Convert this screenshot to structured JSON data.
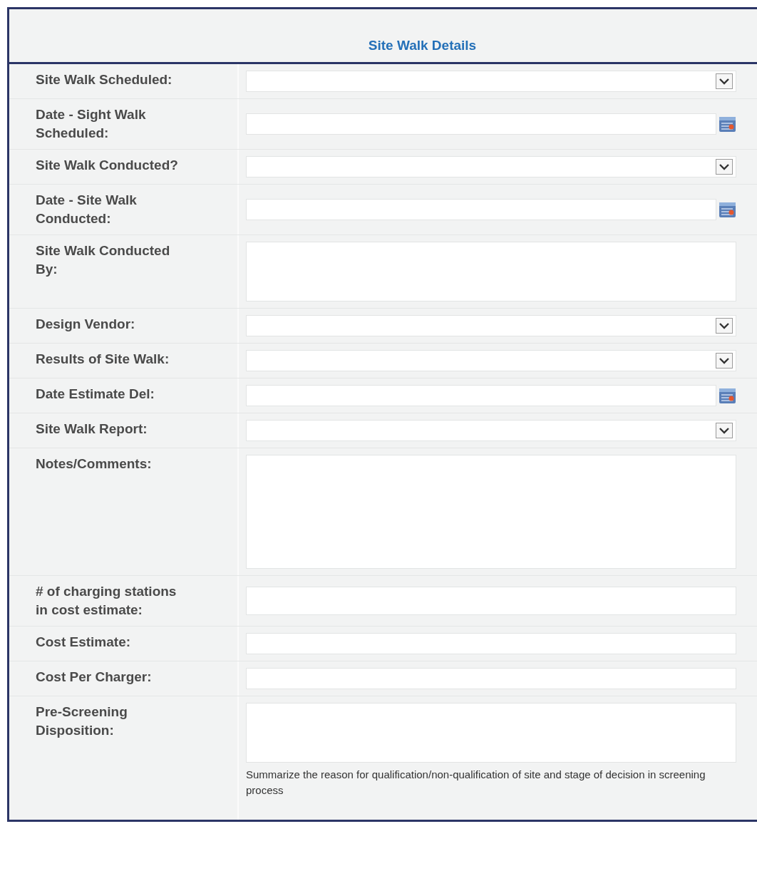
{
  "section": {
    "title": "Site Walk Details"
  },
  "fields": [
    {
      "label": "Site Walk Scheduled:",
      "kind": "select"
    },
    {
      "label": "Date - Sight Walk Scheduled:",
      "kind": "date"
    },
    {
      "label": "Site Walk Conducted?",
      "kind": "select"
    },
    {
      "label": "Date - Site Walk Conducted:",
      "kind": "date"
    },
    {
      "label": "Site Walk Conducted By:",
      "kind": "textarea"
    },
    {
      "label": "Design Vendor:",
      "kind": "select"
    },
    {
      "label": "Results of Site Walk:",
      "kind": "select"
    },
    {
      "label": "Date Estimate Del:",
      "kind": "date"
    },
    {
      "label": "Site Walk Report:",
      "kind": "select"
    },
    {
      "label": "Notes/Comments:",
      "kind": "notes"
    },
    {
      "label": "# of charging stations in cost estimate:",
      "kind": "tall"
    },
    {
      "label": "Cost Estimate:",
      "kind": "text"
    },
    {
      "label": "Cost Per Charger:",
      "kind": "text"
    },
    {
      "label": "Pre-Screening Disposition:",
      "kind": "textarea",
      "help": "Summarize the reason for qualification/non-qualification of site and stage of decision in screening process"
    }
  ]
}
